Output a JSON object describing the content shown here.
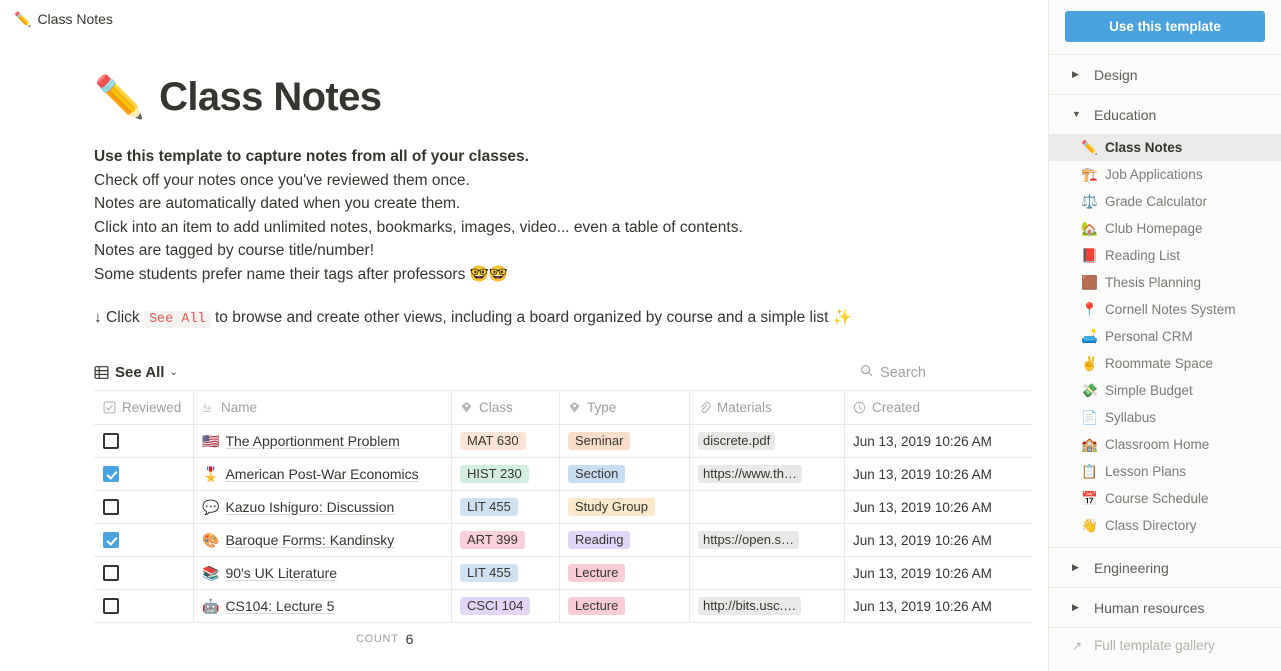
{
  "breadcrumb": {
    "emoji": "✏️",
    "label": "Class Notes"
  },
  "page": {
    "title_emoji": "✏️",
    "title": "Class Notes",
    "description_lines": [
      "Use this template to capture notes from all of your classes.",
      "Check off your notes once you've reviewed them once.",
      "Notes are automatically dated when you create them.",
      "Click into an item to add unlimited notes, bookmarks, images, video... even a table of contents.",
      "Notes are tagged by course title/number!",
      "Some students prefer name their tags after professors 🤓🤓"
    ],
    "callout_prefix": "↓ Click",
    "callout_code": "See All",
    "callout_suffix": "to browse and create other views, including a board organized by course and a simple list ✨"
  },
  "viewbar": {
    "view_icon": "table-grid-icon",
    "view_label": "See All",
    "chevron": "⌄",
    "search_icon": "search-icon",
    "search_placeholder": "Search"
  },
  "table": {
    "columns": [
      {
        "key": "reviewed",
        "label": "Reviewed",
        "icon": "checkbox-property-icon"
      },
      {
        "key": "name",
        "label": "Name",
        "icon": "title-aa-icon"
      },
      {
        "key": "class",
        "label": "Class",
        "icon": "select-property-icon"
      },
      {
        "key": "type",
        "label": "Type",
        "icon": "select-property-icon"
      },
      {
        "key": "materials",
        "label": "Materials",
        "icon": "link-property-icon"
      },
      {
        "key": "created",
        "label": "Created",
        "icon": "clock-property-icon"
      }
    ],
    "rows": [
      {
        "reviewed": false,
        "emoji": "🇺🇸",
        "name": "The Apportionment Problem",
        "class": "MAT 630",
        "class_color": "#fbe4d5",
        "type": "Seminar",
        "type_color": "#fadec9",
        "materials": "discrete.pdf",
        "created": "Jun 13, 2019 10:26 AM"
      },
      {
        "reviewed": true,
        "emoji": "🎖️",
        "name": "American Post-War Economics",
        "class": "HIST 230",
        "class_color": "#d3efe0",
        "type": "Section",
        "type_color": "#c7ddf2",
        "materials": "https://www.th…",
        "created": "Jun 13, 2019 10:26 AM"
      },
      {
        "reviewed": false,
        "emoji": "💬",
        "name": "Kazuo Ishiguro: Discussion",
        "class": "LIT 455",
        "class_color": "#cfe2f3",
        "type": "Study Group",
        "type_color": "#fbeaca",
        "materials": "",
        "created": "Jun 13, 2019 10:26 AM"
      },
      {
        "reviewed": true,
        "emoji": "🎨",
        "name": "Baroque Forms: Kandinsky",
        "class": "ART 399",
        "class_color": "#f9cfd9",
        "type": "Reading",
        "type_color": "#e2d6f8",
        "materials": "https://open.s…",
        "created": "Jun 13, 2019 10:26 AM"
      },
      {
        "reviewed": false,
        "emoji": "📚",
        "name": "90's UK Literature",
        "class": "LIT 455",
        "class_color": "#cfe2f3",
        "type": "Lecture",
        "type_color": "#f9ccd6",
        "materials": "",
        "created": "Jun 13, 2019 10:26 AM"
      },
      {
        "reviewed": false,
        "emoji": "🤖",
        "name": "CS104: Lecture 5",
        "class": "CSCI 104",
        "class_color": "#e2d6f8",
        "type": "Lecture",
        "type_color": "#f9ccd6",
        "materials": "http://bits.usc.…",
        "created": "Jun 13, 2019 10:26 AM"
      }
    ],
    "count_label": "COUNT",
    "count_value": "6"
  },
  "sidebar": {
    "use_template_label": "Use this template",
    "sections": [
      {
        "label": "Design",
        "expanded": false,
        "triangle": "▶"
      },
      {
        "label": "Education",
        "expanded": true,
        "triangle": "▼"
      }
    ],
    "templates": [
      {
        "emoji": "✏️",
        "label": "Class Notes",
        "active": true
      },
      {
        "emoji": "🏗️",
        "label": "Job Applications",
        "active": false
      },
      {
        "emoji": "⚖️",
        "label": "Grade Calculator",
        "active": false
      },
      {
        "emoji": "🏡",
        "label": "Club Homepage",
        "active": false
      },
      {
        "emoji": "📕",
        "label": "Reading List",
        "active": false
      },
      {
        "emoji": "🟫",
        "label": "Thesis Planning",
        "active": false
      },
      {
        "emoji": "📍",
        "label": "Cornell Notes System",
        "active": false
      },
      {
        "emoji": "🛋️",
        "label": "Personal CRM",
        "active": false
      },
      {
        "emoji": "✌️",
        "label": "Roommate Space",
        "active": false
      },
      {
        "emoji": "💸",
        "label": "Simple Budget",
        "active": false
      },
      {
        "emoji": "📄",
        "label": "Syllabus",
        "active": false
      },
      {
        "emoji": "🏫",
        "label": "Classroom Home",
        "active": false
      },
      {
        "emoji": "📋",
        "label": "Lesson Plans",
        "active": false
      },
      {
        "emoji": "📅",
        "label": "Course Schedule",
        "active": false
      },
      {
        "emoji": "👋",
        "label": "Class Directory",
        "active": false
      }
    ],
    "sections_after": [
      {
        "label": "Engineering",
        "expanded": false,
        "triangle": "▶"
      },
      {
        "label": "Human resources",
        "expanded": false,
        "triangle": "▶"
      }
    ],
    "gallery_label": "Full template gallery",
    "gallery_arrow": "↗"
  },
  "colors": {
    "accent": "#4aa3df",
    "text": "#37352f",
    "muted": "#a09f9b",
    "sidebar_bg": "#fbfbfa"
  }
}
